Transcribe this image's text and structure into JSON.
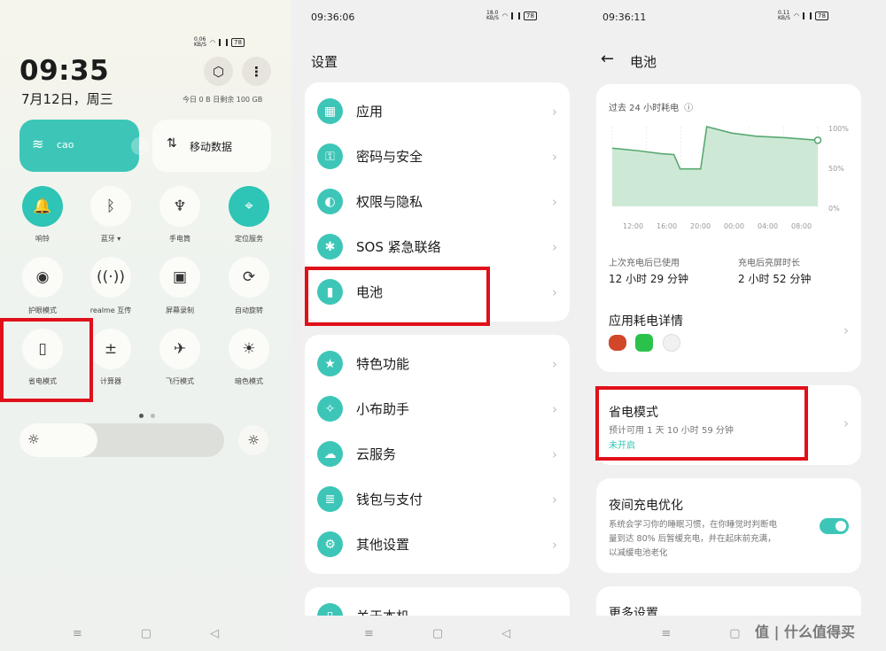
{
  "panel1": {
    "status": {
      "speed": "0.06\nKB/S",
      "battery": "78"
    },
    "clock": "09:35",
    "date": "7月12日，周三",
    "data_usage": "今日 0 B 日剩余 100 GB",
    "wifi_tile": {
      "label": "cao"
    },
    "mobile_tile": {
      "label": "移动数据"
    },
    "tiles": [
      {
        "label": "响铃"
      },
      {
        "label": "蓝牙 ▾"
      },
      {
        "label": "手电筒"
      },
      {
        "label": "定位服务"
      },
      {
        "label": "护眼模式"
      },
      {
        "label": "realme 互传"
      },
      {
        "label": "屏幕录制"
      },
      {
        "label": "自动旋转"
      },
      {
        "label": "省电模式"
      },
      {
        "label": "计算器"
      },
      {
        "label": "飞行模式"
      },
      {
        "label": "暗色模式"
      }
    ],
    "brightness_level": 0.38
  },
  "panel2": {
    "status": {
      "time": "09:36:06",
      "speed": "18.0\nKB/S",
      "battery": "78"
    },
    "title": "设置",
    "group1": [
      {
        "label": "应用"
      },
      {
        "label": "密码与安全"
      },
      {
        "label": "权限与隐私"
      },
      {
        "label": "SOS 紧急联络"
      },
      {
        "label": "电池"
      }
    ],
    "group2": [
      {
        "label": "特色功能"
      },
      {
        "label": "小布助手"
      },
      {
        "label": "云服务"
      },
      {
        "label": "钱包与支付"
      },
      {
        "label": "其他设置"
      }
    ],
    "group3": [
      {
        "label": "关于本机"
      }
    ]
  },
  "panel3": {
    "status": {
      "time": "09:36:11",
      "speed": "0.11\nKB/S",
      "battery": "78"
    },
    "title": "电池",
    "chart_title": "过去 24 小时耗电",
    "chart_data": {
      "type": "area",
      "x": [
        "12:00",
        "16:00",
        "20:00",
        "00:00",
        "04:00",
        "08:00"
      ],
      "yticks": [
        "100%",
        "50%",
        "0%"
      ],
      "ylim": [
        0,
        100
      ]
    },
    "last_charge_label": "上次充电后已使用",
    "last_charge_value": "12 小时 29 分钟",
    "screen_label": "充电后亮屏时长",
    "screen_value": "2 小时 52 分钟",
    "app_usage": "应用耗电详情",
    "power_saving": {
      "title": "省电模式",
      "estimate": "预计可用 1 天 10 小时 59 分钟",
      "status": "未开启"
    },
    "night_charge": {
      "title": "夜间充电优化",
      "desc1": "系统会学习你的睡眠习惯，在你睡觉时判断电",
      "desc2": "量到达 80% 后暂缓充电，并在起床前充满，",
      "desc3": "以减缓电池老化"
    },
    "more": "更多设置"
  },
  "watermark": "值 | 什么值得买"
}
